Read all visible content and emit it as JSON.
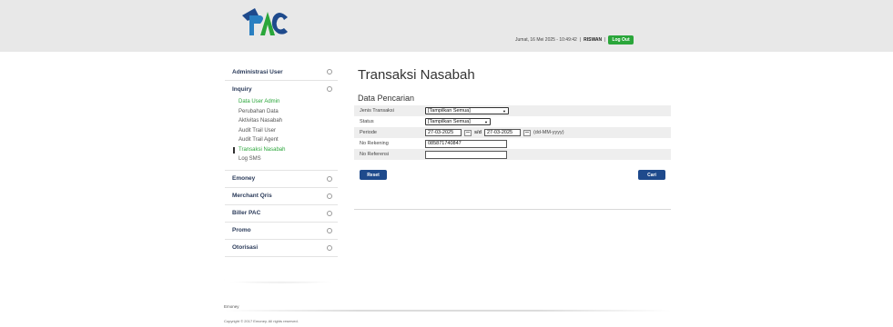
{
  "header": {
    "logo_text": "PAC",
    "date_time": "Jumat, 16 Mei 2025 - 10:49:42",
    "separator": "|",
    "username": "RISWAN",
    "logout_label": "Log Out"
  },
  "sidebar": {
    "sections": [
      {
        "label": "Administrasi User",
        "items": []
      },
      {
        "label": "Inquiry",
        "items": [
          "Data User Admin",
          "Perubahan Data",
          "Aktivitas Nasabah",
          "Audit Trail User",
          "Audit Trail Agent",
          "Transaksi Nasabah",
          "Log SMS"
        ]
      },
      {
        "label": "Emoney",
        "items": []
      },
      {
        "label": "Merchant Qris",
        "items": []
      },
      {
        "label": "Biller PAC",
        "items": []
      },
      {
        "label": "Promo",
        "items": []
      },
      {
        "label": "Otorisasi",
        "items": []
      }
    ],
    "highlighted_item": "Data User Admin",
    "current_item": "Transaksi Nasabah"
  },
  "main": {
    "title": "Transaksi Nasabah",
    "section_title": "Data Pencarian",
    "fields": {
      "jenis_transaksi": {
        "label": "Jenis Transaksi",
        "value": "[Tampilkan Semua]"
      },
      "status": {
        "label": "Status",
        "value": "[Tampilkan Semua]"
      },
      "periode": {
        "label": "Periode",
        "from": "27-03-2025",
        "sd": "s/d",
        "to": "27-03-2025",
        "format": "(dd-MM-yyyy)"
      },
      "no_rekening": {
        "label": "No Rekening",
        "value": "085871740847"
      },
      "no_referensi": {
        "label": "No Referensi",
        "value": ""
      }
    },
    "reset_label": "Reset",
    "search_label": "Cari"
  },
  "footer": {
    "brand": "Emoney",
    "copyright": "Copyright © 2017 Emoney. All rights reserved."
  },
  "colors": {
    "accent_green": "#2aa63a",
    "button_blue": "#1e4a8c",
    "header_bg": "#e8e8e8"
  }
}
